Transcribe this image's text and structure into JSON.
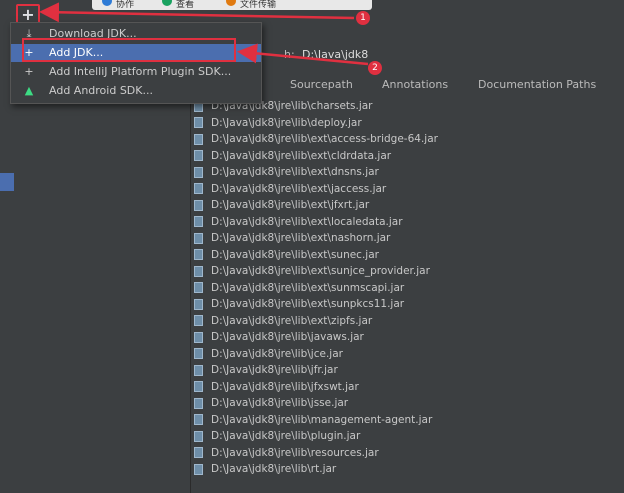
{
  "toolbar": {
    "add_symbol": "+",
    "remove_symbol": "−"
  },
  "taskbar": {
    "items": [
      {
        "label": "协作",
        "color": "#2e7bd6"
      },
      {
        "label": "查看",
        "color": "#1aa260"
      },
      {
        "label": "文件传输",
        "color": "#e07a10"
      }
    ]
  },
  "menu": {
    "items": [
      {
        "label": "Download JDK...",
        "icon": "download-icon",
        "glyph": "⤓"
      },
      {
        "label": "Add JDK...",
        "icon": "add-jdk-icon",
        "glyph": "+"
      },
      {
        "label": "Add IntelliJ Platform Plugin SDK...",
        "icon": "plugin-sdk-icon",
        "glyph": "+"
      },
      {
        "label": "Add Android SDK...",
        "icon": "android-icon",
        "glyph": "▲"
      }
    ]
  },
  "sdk": {
    "path_label": "h:",
    "path_value": "D:\\Java\\jdk8"
  },
  "tabs": [
    "Sourcepath",
    "Annotations",
    "Documentation Paths"
  ],
  "classpath": [
    "D:\\Java\\jdk8\\jre\\lib\\charsets.jar",
    "D:\\Java\\jdk8\\jre\\lib\\deploy.jar",
    "D:\\Java\\jdk8\\jre\\lib\\ext\\access-bridge-64.jar",
    "D:\\Java\\jdk8\\jre\\lib\\ext\\cldrdata.jar",
    "D:\\Java\\jdk8\\jre\\lib\\ext\\dnsns.jar",
    "D:\\Java\\jdk8\\jre\\lib\\ext\\jaccess.jar",
    "D:\\Java\\jdk8\\jre\\lib\\ext\\jfxrt.jar",
    "D:\\Java\\jdk8\\jre\\lib\\ext\\localedata.jar",
    "D:\\Java\\jdk8\\jre\\lib\\ext\\nashorn.jar",
    "D:\\Java\\jdk8\\jre\\lib\\ext\\sunec.jar",
    "D:\\Java\\jdk8\\jre\\lib\\ext\\sunjce_provider.jar",
    "D:\\Java\\jdk8\\jre\\lib\\ext\\sunmscapi.jar",
    "D:\\Java\\jdk8\\jre\\lib\\ext\\sunpkcs11.jar",
    "D:\\Java\\jdk8\\jre\\lib\\ext\\zipfs.jar",
    "D:\\Java\\jdk8\\jre\\lib\\javaws.jar",
    "D:\\Java\\jdk8\\jre\\lib\\jce.jar",
    "D:\\Java\\jdk8\\jre\\lib\\jfr.jar",
    "D:\\Java\\jdk8\\jre\\lib\\jfxswt.jar",
    "D:\\Java\\jdk8\\jre\\lib\\jsse.jar",
    "D:\\Java\\jdk8\\jre\\lib\\management-agent.jar",
    "D:\\Java\\jdk8\\jre\\lib\\plugin.jar",
    "D:\\Java\\jdk8\\jre\\lib\\resources.jar",
    "D:\\Java\\jdk8\\jre\\lib\\rt.jar"
  ],
  "annotations": {
    "badge1": "1",
    "badge2": "2",
    "accent": "#e03040"
  }
}
